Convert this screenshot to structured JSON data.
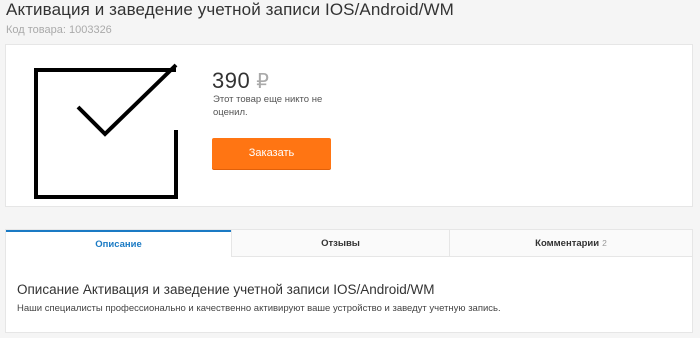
{
  "product": {
    "title": "Активация и заведение учетной записи IOS/Android/WM",
    "sku_label": "Код товара: 1003326",
    "image_icon": "checkmark-in-box-icon",
    "price": "390",
    "currency": "₽",
    "rating_note": "Этот товар еще никто не оценил.",
    "order_label": "Заказать"
  },
  "tabs": [
    {
      "label": "Описание",
      "count": "",
      "active": true
    },
    {
      "label": "Отзывы",
      "count": "",
      "active": false
    },
    {
      "label": "Комментарии",
      "count": "2",
      "active": false
    }
  ],
  "description": {
    "title": "Описание Активация и заведение учетной записи IOS/Android/WM",
    "text": "Наши специалисты профессионально и качественно активируют ваше устройство и заведут учетную запись."
  },
  "colors": {
    "accent": "#1a7ac4",
    "order_button": "#ff7513"
  }
}
